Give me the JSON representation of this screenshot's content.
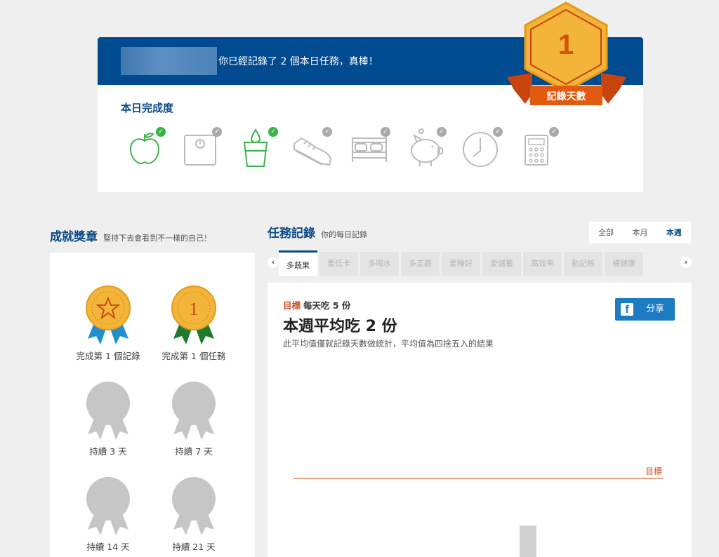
{
  "banner": {
    "message": "你已經記錄了 2 個本日任務，真棒！"
  },
  "day_badge": {
    "count": "1",
    "label": "記錄天數"
  },
  "daily": {
    "title": "本日完成度",
    "tasks": [
      {
        "icon": "apple-icon",
        "done": true
      },
      {
        "icon": "scale-icon",
        "done": false
      },
      {
        "icon": "water-glass-icon",
        "done": true
      },
      {
        "icon": "shoe-icon",
        "done": false
      },
      {
        "icon": "bed-icon",
        "done": false
      },
      {
        "icon": "piggy-bank-icon",
        "done": false
      },
      {
        "icon": "clock-icon",
        "done": false
      },
      {
        "icon": "calculator-icon",
        "done": false
      }
    ]
  },
  "achievements": {
    "title": "成就獎章",
    "subtitle": "堅持下去會看到不一樣的自己！",
    "medals": [
      {
        "caption": "完成第 1 個記錄",
        "kind": "star",
        "earned": true
      },
      {
        "caption": "完成第 1 個任務",
        "kind": "one",
        "earned": true
      },
      {
        "caption": "持續 3 天",
        "kind": "plain",
        "earned": false
      },
      {
        "caption": "持續 7 天",
        "kind": "plain",
        "earned": false
      },
      {
        "caption": "持續 14 天",
        "kind": "plain",
        "earned": false
      },
      {
        "caption": "持續 21 天",
        "kind": "plain",
        "earned": false
      }
    ]
  },
  "records": {
    "title": "任務記錄",
    "subtitle": "你的每日記錄",
    "range_tabs": [
      "全部",
      "本月",
      "本週"
    ],
    "active_range": 2,
    "task_tabs": [
      "多蔬果",
      "要低卡",
      "多喝水",
      "多走路",
      "要睡好",
      "愛儲蓄",
      "高效率",
      "勤記帳",
      "補健康"
    ],
    "active_task": 0,
    "goal_label": "目標",
    "goal_value": "每天吃 5 份",
    "avg_title": "本週平均吃 2 份",
    "avg_note": "此平均值僅就記錄天數做統計，平均值為四捨五入的結果",
    "share_label": "分享",
    "colors": {
      "brand": "#004a8f",
      "accent": "#d34b1f",
      "share": "#1d7bc4"
    }
  },
  "chart_data": {
    "type": "bar",
    "target_label": "目標",
    "target": 5,
    "values": [
      2
    ],
    "ylim": [
      0,
      11
    ]
  }
}
